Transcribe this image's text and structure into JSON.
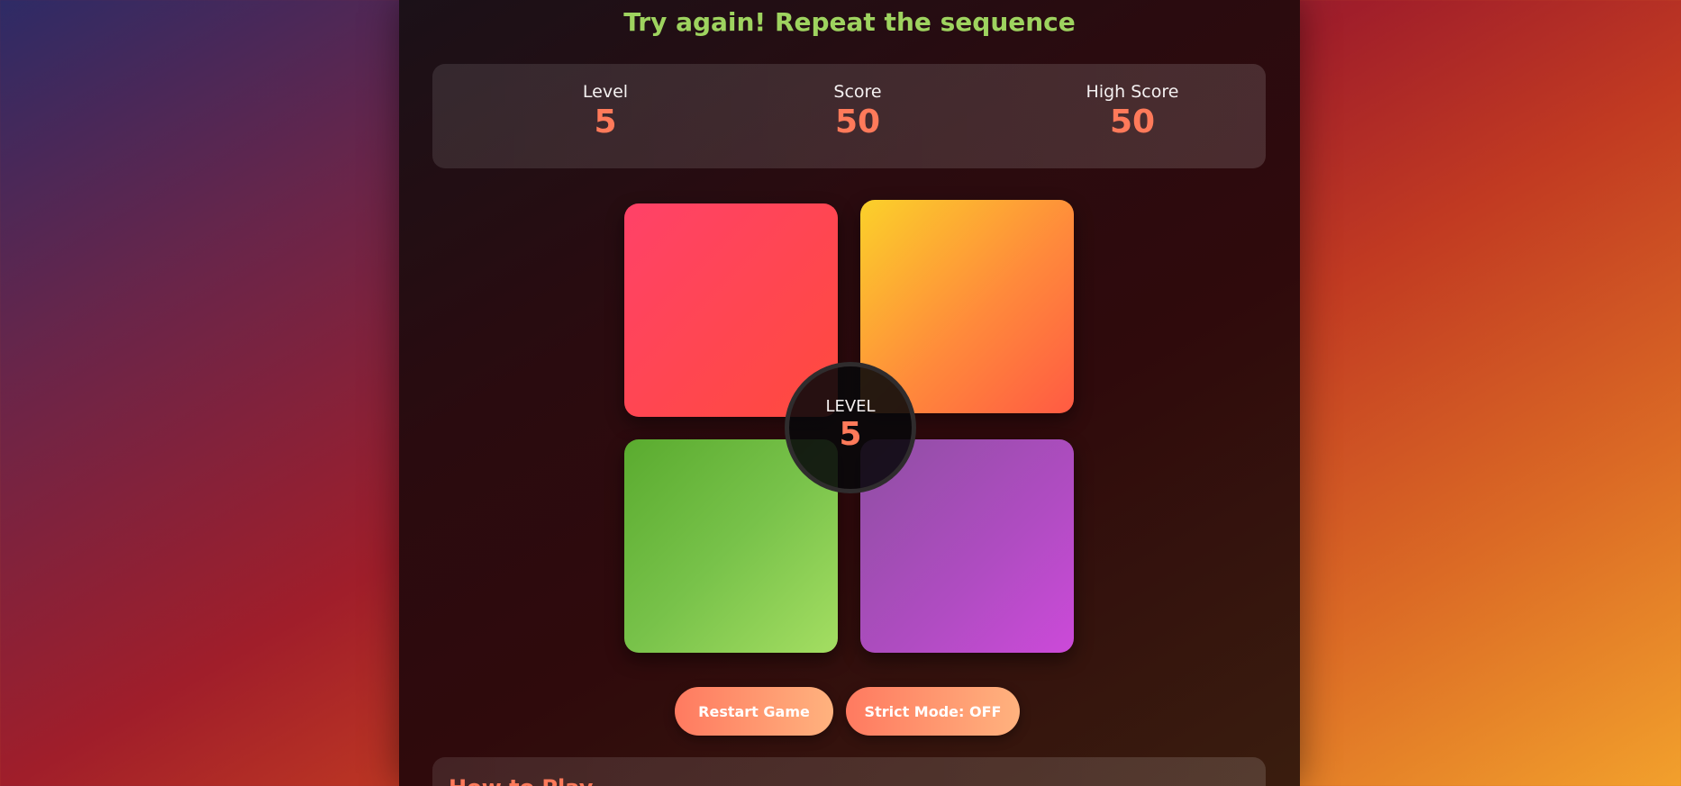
{
  "status_message": "Try again! Repeat the sequence",
  "stats": {
    "level_label": "Level",
    "level_value": "5",
    "score_label": "Score",
    "score_value": "50",
    "high_score_label": "High Score",
    "high_score_value": "50"
  },
  "pads": [
    {
      "name": "red",
      "color": "#ff4558"
    },
    {
      "name": "yellow",
      "color": "#fbb030"
    },
    {
      "name": "green",
      "color": "#7cc44c"
    },
    {
      "name": "purple",
      "color": "#b04cc2"
    }
  ],
  "center": {
    "label": "LEVEL",
    "value": "5"
  },
  "buttons": {
    "restart_label": "Restart Game",
    "strict_label": "Strict Mode: OFF"
  },
  "how_to_play": {
    "title": "How to Play"
  },
  "colors": {
    "accent": "#ff7a5a",
    "status_green": "#9ed35f"
  }
}
